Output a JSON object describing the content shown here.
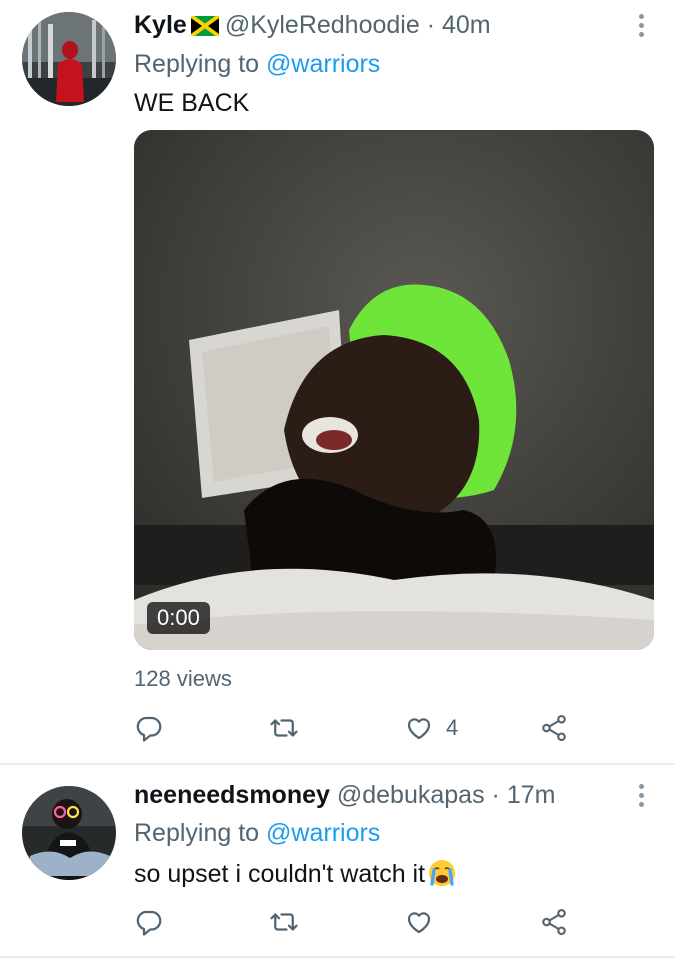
{
  "tweets": [
    {
      "author_name": "Kyle",
      "flag": "jamaica-flag",
      "handle": "@KyleRedhoodie",
      "dot": "·",
      "time": "40m",
      "replying_prefix": "Replying to",
      "replying_to": "@warriors",
      "text": "WE BACK",
      "video_duration": "0:00",
      "views": "128 views",
      "like_count": "4"
    },
    {
      "author_name": "neeneedsmoney",
      "handle": "@debukapas",
      "dot": "·",
      "time": "17m",
      "replying_prefix": "Replying to",
      "replying_to": "@warriors",
      "text": "so upset i couldn't watch it",
      "emoji": "loudly-crying-face",
      "like_count": ""
    }
  ],
  "icons": [
    "reply-icon",
    "retweet-icon",
    "like-icon",
    "share-icon",
    "more-icon"
  ],
  "colors": {
    "link": "#1d9bf0",
    "secondary_text": "#536471",
    "primary_text": "#0f1419",
    "icon": "#536471",
    "divider": "#e9ecee"
  }
}
